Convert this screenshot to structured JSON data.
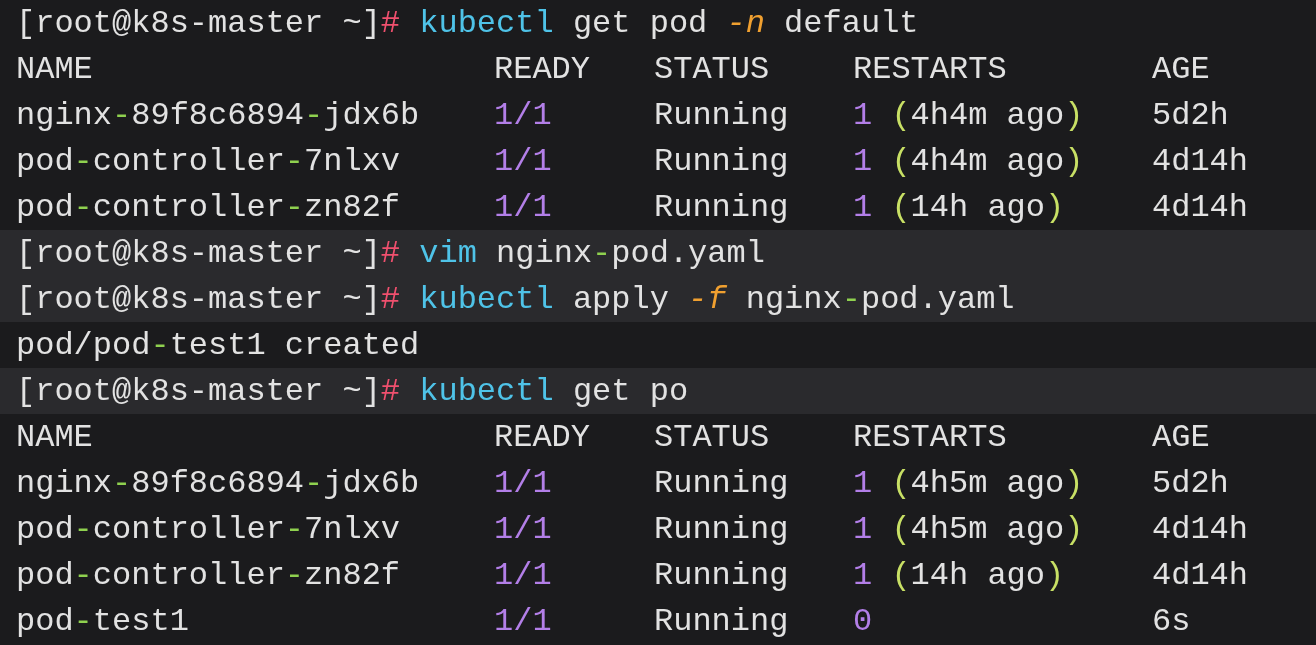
{
  "terminal": {
    "lines": [
      {
        "kind": "command",
        "highlighted": false,
        "tokens": [
          {
            "kind": "plain",
            "text": "[root@k8s-master ~]"
          },
          {
            "kind": "hash",
            "text": "#"
          },
          {
            "kind": "cmd",
            "text": "kubectl"
          },
          {
            "kind": "plain",
            "text": " get pod "
          },
          {
            "kind": "flag",
            "text": "-n"
          },
          {
            "kind": "plain",
            "text": " default"
          }
        ]
      },
      {
        "kind": "header",
        "highlighted": false,
        "cells": [
          "NAME",
          "READY",
          "STATUS",
          "RESTARTS",
          "AGE"
        ]
      },
      {
        "kind": "row",
        "highlighted": false,
        "cells": [
          [
            {
              "kind": "plain",
              "text": "nginx"
            },
            {
              "kind": "dash",
              "text": "-"
            },
            {
              "kind": "plain",
              "text": "89f8c6894"
            },
            {
              "kind": "dash",
              "text": "-"
            },
            {
              "kind": "plain",
              "text": "jdx6b"
            }
          ],
          [
            {
              "kind": "num",
              "text": "1/1"
            }
          ],
          [
            {
              "kind": "plain",
              "text": "Running"
            }
          ],
          [
            {
              "kind": "num",
              "text": "1"
            },
            {
              "kind": "paren",
              "text": "("
            },
            {
              "kind": "plain",
              "text": "4h4m ago"
            },
            {
              "kind": "paren",
              "text": ")"
            }
          ],
          [
            {
              "kind": "plain",
              "text": "5d2h"
            }
          ]
        ]
      },
      {
        "kind": "row",
        "highlighted": false,
        "cells": [
          [
            {
              "kind": "plain",
              "text": "pod"
            },
            {
              "kind": "dash",
              "text": "-"
            },
            {
              "kind": "plain",
              "text": "controller"
            },
            {
              "kind": "dash",
              "text": "-"
            },
            {
              "kind": "plain",
              "text": "7nlxv"
            }
          ],
          [
            {
              "kind": "num",
              "text": "1/1"
            }
          ],
          [
            {
              "kind": "plain",
              "text": "Running"
            }
          ],
          [
            {
              "kind": "num",
              "text": "1"
            },
            {
              "kind": "paren",
              "text": "("
            },
            {
              "kind": "plain",
              "text": "4h4m ago"
            },
            {
              "kind": "paren",
              "text": ")"
            }
          ],
          [
            {
              "kind": "plain",
              "text": "4d14h"
            }
          ]
        ]
      },
      {
        "kind": "row",
        "highlighted": false,
        "cells": [
          [
            {
              "kind": "plain",
              "text": "pod"
            },
            {
              "kind": "dash",
              "text": "-"
            },
            {
              "kind": "plain",
              "text": "controller"
            },
            {
              "kind": "dash",
              "text": "-"
            },
            {
              "kind": "plain",
              "text": "zn82f"
            }
          ],
          [
            {
              "kind": "num",
              "text": "1/1"
            }
          ],
          [
            {
              "kind": "plain",
              "text": "Running"
            }
          ],
          [
            {
              "kind": "num",
              "text": "1"
            },
            {
              "kind": "paren",
              "text": "("
            },
            {
              "kind": "plain",
              "text": "14h ago"
            },
            {
              "kind": "paren",
              "text": ")"
            }
          ],
          [
            {
              "kind": "plain",
              "text": "4d14h"
            }
          ]
        ]
      },
      {
        "kind": "command",
        "highlighted": true,
        "tokens": [
          {
            "kind": "plain",
            "text": "[root@k8s-master ~]"
          },
          {
            "kind": "hash",
            "text": "#"
          },
          {
            "kind": "cmd",
            "text": "vim"
          },
          {
            "kind": "plain",
            "text": " nginx"
          },
          {
            "kind": "dash",
            "text": "-"
          },
          {
            "kind": "plain",
            "text": "pod.yaml"
          }
        ]
      },
      {
        "kind": "command",
        "highlighted": true,
        "tokens": [
          {
            "kind": "plain",
            "text": "[root@k8s-master ~]"
          },
          {
            "kind": "hash",
            "text": "#"
          },
          {
            "kind": "cmd",
            "text": "kubectl"
          },
          {
            "kind": "plain",
            "text": " apply "
          },
          {
            "kind": "flag",
            "text": "-f"
          },
          {
            "kind": "plain",
            "text": " nginx"
          },
          {
            "kind": "dash",
            "text": "-"
          },
          {
            "kind": "plain",
            "text": "pod.yaml"
          }
        ]
      },
      {
        "kind": "output",
        "highlighted": false,
        "tokens": [
          {
            "kind": "plain",
            "text": "pod/pod"
          },
          {
            "kind": "dash",
            "text": "-"
          },
          {
            "kind": "plain",
            "text": "test1 created"
          }
        ]
      },
      {
        "kind": "command",
        "highlighted": true,
        "tokens": [
          {
            "kind": "plain",
            "text": "[root@k8s-master ~]"
          },
          {
            "kind": "hash",
            "text": "#"
          },
          {
            "kind": "cmd",
            "text": "kubectl"
          },
          {
            "kind": "plain",
            "text": " get po"
          }
        ]
      },
      {
        "kind": "header",
        "highlighted": false,
        "cells": [
          "NAME",
          "READY",
          "STATUS",
          "RESTARTS",
          "AGE"
        ]
      },
      {
        "kind": "row",
        "highlighted": false,
        "cells": [
          [
            {
              "kind": "plain",
              "text": "nginx"
            },
            {
              "kind": "dash",
              "text": "-"
            },
            {
              "kind": "plain",
              "text": "89f8c6894"
            },
            {
              "kind": "dash",
              "text": "-"
            },
            {
              "kind": "plain",
              "text": "jdx6b"
            }
          ],
          [
            {
              "kind": "num",
              "text": "1/1"
            }
          ],
          [
            {
              "kind": "plain",
              "text": "Running"
            }
          ],
          [
            {
              "kind": "num",
              "text": "1"
            },
            {
              "kind": "paren",
              "text": "("
            },
            {
              "kind": "plain",
              "text": "4h5m ago"
            },
            {
              "kind": "paren",
              "text": ")"
            }
          ],
          [
            {
              "kind": "plain",
              "text": "5d2h"
            }
          ]
        ]
      },
      {
        "kind": "row",
        "highlighted": false,
        "cells": [
          [
            {
              "kind": "plain",
              "text": "pod"
            },
            {
              "kind": "dash",
              "text": "-"
            },
            {
              "kind": "plain",
              "text": "controller"
            },
            {
              "kind": "dash",
              "text": "-"
            },
            {
              "kind": "plain",
              "text": "7nlxv"
            }
          ],
          [
            {
              "kind": "num",
              "text": "1/1"
            }
          ],
          [
            {
              "kind": "plain",
              "text": "Running"
            }
          ],
          [
            {
              "kind": "num",
              "text": "1"
            },
            {
              "kind": "paren",
              "text": "("
            },
            {
              "kind": "plain",
              "text": "4h5m ago"
            },
            {
              "kind": "paren",
              "text": ")"
            }
          ],
          [
            {
              "kind": "plain",
              "text": "4d14h"
            }
          ]
        ]
      },
      {
        "kind": "row",
        "highlighted": false,
        "cells": [
          [
            {
              "kind": "plain",
              "text": "pod"
            },
            {
              "kind": "dash",
              "text": "-"
            },
            {
              "kind": "plain",
              "text": "controller"
            },
            {
              "kind": "dash",
              "text": "-"
            },
            {
              "kind": "plain",
              "text": "zn82f"
            }
          ],
          [
            {
              "kind": "num",
              "text": "1/1"
            }
          ],
          [
            {
              "kind": "plain",
              "text": "Running"
            }
          ],
          [
            {
              "kind": "num",
              "text": "1"
            },
            {
              "kind": "paren",
              "text": "("
            },
            {
              "kind": "plain",
              "text": "14h ago"
            },
            {
              "kind": "paren",
              "text": ")"
            }
          ],
          [
            {
              "kind": "plain",
              "text": "4d14h"
            }
          ]
        ]
      },
      {
        "kind": "row",
        "highlighted": false,
        "cells": [
          [
            {
              "kind": "plain",
              "text": "pod"
            },
            {
              "kind": "dash",
              "text": "-"
            },
            {
              "kind": "plain",
              "text": "test1"
            }
          ],
          [
            {
              "kind": "num",
              "text": "1/1"
            }
          ],
          [
            {
              "kind": "plain",
              "text": "Running"
            }
          ],
          [
            {
              "kind": "num",
              "text": "0"
            }
          ],
          [
            {
              "kind": "plain",
              "text": "6s"
            }
          ]
        ]
      }
    ]
  }
}
